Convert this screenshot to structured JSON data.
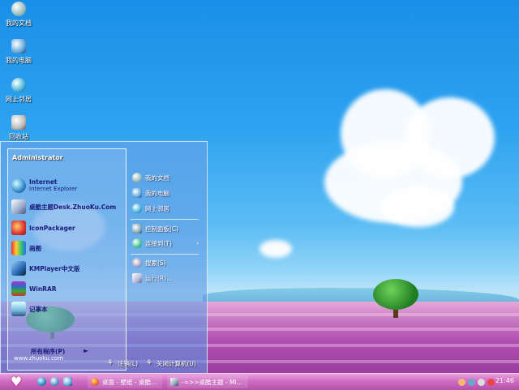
{
  "desktop": {
    "icons": [
      {
        "label": "我的文档",
        "icon": "my-documents-icon"
      },
      {
        "label": "我的电脑",
        "icon": "my-computer-icon"
      },
      {
        "label": "网上邻居",
        "icon": "network-places-icon"
      },
      {
        "label": "回收站",
        "icon": "recycle-bin-icon"
      }
    ]
  },
  "start_menu": {
    "user": "Administrator",
    "programs": [
      {
        "label": "Internet",
        "sublabel": "Internet Explorer",
        "icon": "internet-explorer-icon"
      },
      {
        "label": "桌酷主题Desk.ZhuoKu.Com",
        "icon": "zhuoku-theme-icon"
      },
      {
        "label": "IconPackager",
        "icon": "iconpackager-icon"
      },
      {
        "label": "画图",
        "icon": "paint-icon"
      },
      {
        "label": "KMPlayer中文版",
        "icon": "kmplayer-icon"
      },
      {
        "label": "WinRAR",
        "icon": "winrar-icon"
      },
      {
        "label": "记事本",
        "icon": "notepad-icon"
      }
    ],
    "all_programs": "所有程序(P)",
    "site": "www.zhuoku.com",
    "right_items": [
      {
        "label": "我的文档",
        "icon": "my-documents-icon"
      },
      {
        "label": "我的电脑",
        "icon": "my-computer-icon"
      },
      {
        "label": "网上邻居",
        "icon": "network-places-icon"
      },
      {
        "label": "控制面板(C)",
        "icon": "control-panel-icon"
      },
      {
        "label": "连接到(T)",
        "icon": "connect-to-icon",
        "arrow": "›"
      },
      {
        "label": "搜索(S)",
        "icon": "search-icon"
      },
      {
        "label": "运行(R)...",
        "icon": "run-icon"
      }
    ],
    "logoff": "注销(L)",
    "shutdown": "关闭计算机(U)"
  },
  "taskbar": {
    "start_icon": "heart-icon",
    "quick_launch": [
      "ie-icon",
      "media-icon",
      "desktop-icon"
    ],
    "tasks": [
      {
        "label": "桌面 - 壁纸 - 桌酷...",
        "icon": "browser-icon"
      },
      {
        "label": "-=>>桌酷主题 - Mi...",
        "icon": "window-icon"
      }
    ],
    "tray_icons": [
      "person-icon",
      "network-tray-icon",
      "volume-icon",
      "antivirus-icon"
    ],
    "clock": "21:46"
  },
  "colors": {
    "sky": "#2fa3f0",
    "field": "#b04eb0",
    "taskbar": "#cf6cc4",
    "menu_text": "#1a1a7a"
  }
}
